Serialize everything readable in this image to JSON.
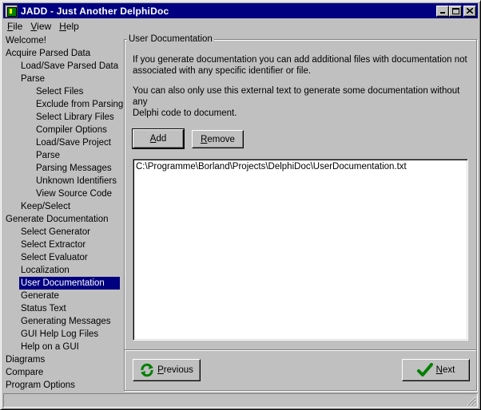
{
  "window": {
    "title": "JADD - Just Another DelphiDoc"
  },
  "menu": {
    "file": "ile",
    "file_key": "F",
    "view": "iew",
    "view_key": "V",
    "help": "elp",
    "help_key": "H"
  },
  "nav": {
    "items": [
      {
        "label": "Welcome!",
        "level": 0
      },
      {
        "label": "Acquire Parsed Data",
        "level": 0
      },
      {
        "label": "Load/Save Parsed Data",
        "level": 1
      },
      {
        "label": "Parse",
        "level": 1
      },
      {
        "label": "Select Files",
        "level": 2
      },
      {
        "label": "Exclude from Parsing",
        "level": 2
      },
      {
        "label": "Select Library Files",
        "level": 2
      },
      {
        "label": "Compiler Options",
        "level": 2
      },
      {
        "label": "Load/Save Project",
        "level": 2
      },
      {
        "label": "Parse",
        "level": 2
      },
      {
        "label": "Parsing Messages",
        "level": 2
      },
      {
        "label": "Unknown Identifiers",
        "level": 2
      },
      {
        "label": "View Source Code",
        "level": 2
      },
      {
        "label": "Keep/Select",
        "level": 1
      },
      {
        "label": "Generate Documentation",
        "level": 0
      },
      {
        "label": "Select Generator",
        "level": 1
      },
      {
        "label": "Select Extractor",
        "level": 1
      },
      {
        "label": "Select Evaluator",
        "level": 1
      },
      {
        "label": "Localization",
        "level": 1
      },
      {
        "label": "User Documentation",
        "level": 1,
        "selected": true
      },
      {
        "label": "Generate",
        "level": 1
      },
      {
        "label": "Status Text",
        "level": 1
      },
      {
        "label": "Generating Messages",
        "level": 1
      },
      {
        "label": "GUI Help Log Files",
        "level": 1
      },
      {
        "label": "Help on a GUI",
        "level": 1
      },
      {
        "label": "Diagrams",
        "level": 0
      },
      {
        "label": "Compare",
        "level": 0
      },
      {
        "label": "Program Options",
        "level": 0
      }
    ]
  },
  "page": {
    "group_title": "User Documentation",
    "desc1_line1": "If you generate documentation you can add additional files with documentation not",
    "desc1_line2": "associated with any specific identifier or file.",
    "desc2_line1": "You can also only use this external text to generate some documentation without any",
    "desc2_line2": "Delphi code to document.",
    "add_key": "A",
    "add_rest": "dd",
    "remove_key": "R",
    "remove_rest": "emove",
    "files": [
      "C:\\Programme\\Borland\\Projects\\DelphiDoc\\UserDocumentation.txt"
    ]
  },
  "footer": {
    "previous_key": "P",
    "previous_rest": "revious",
    "next_key": "N",
    "next_rest": "ext"
  },
  "colors": {
    "selection": "#000080",
    "face": "#c0c0c0",
    "titlebar": "#000080"
  },
  "icons": {
    "previous": "refresh-arrows-icon",
    "next": "checkmark-icon"
  }
}
